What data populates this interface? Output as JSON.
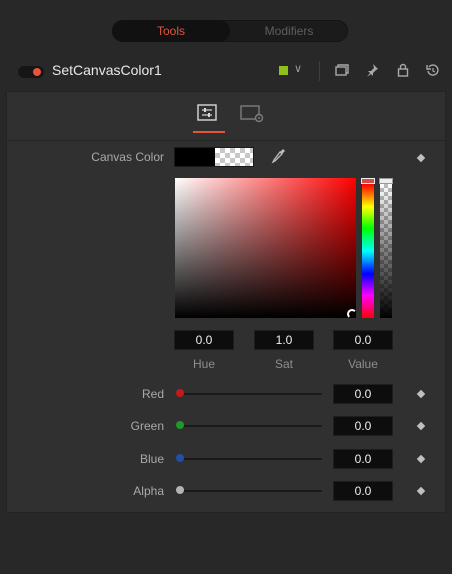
{
  "tabs": {
    "tools": "Tools",
    "modifiers": "Modifiers"
  },
  "node": {
    "name": "SetCanvasColor1",
    "color": "#8ec21a",
    "chevron": "∨"
  },
  "header_icons": [
    "restore-window-icon",
    "pin-icon",
    "lock-icon",
    "reset-icon"
  ],
  "panel_tabs": [
    "controls-tab-icon",
    "settings-tab-icon"
  ],
  "canvas_color": {
    "label": "Canvas Color",
    "solid_color": "#000000",
    "transparent": true
  },
  "hsv": {
    "hue": {
      "label": "Hue",
      "value": "0.0"
    },
    "sat": {
      "label": "Sat",
      "value": "1.0"
    },
    "val": {
      "label": "Value",
      "value": "0.0"
    }
  },
  "channels": [
    {
      "label": "Red",
      "value": "0.0",
      "knob_color": "#c41a1a"
    },
    {
      "label": "Green",
      "value": "0.0",
      "knob_color": "#1f9a2a"
    },
    {
      "label": "Blue",
      "value": "0.0",
      "knob_color": "#1f4fa8"
    },
    {
      "label": "Alpha",
      "value": "0.0",
      "knob_color": "#b4b4b4"
    }
  ],
  "accent": "#e8533b"
}
